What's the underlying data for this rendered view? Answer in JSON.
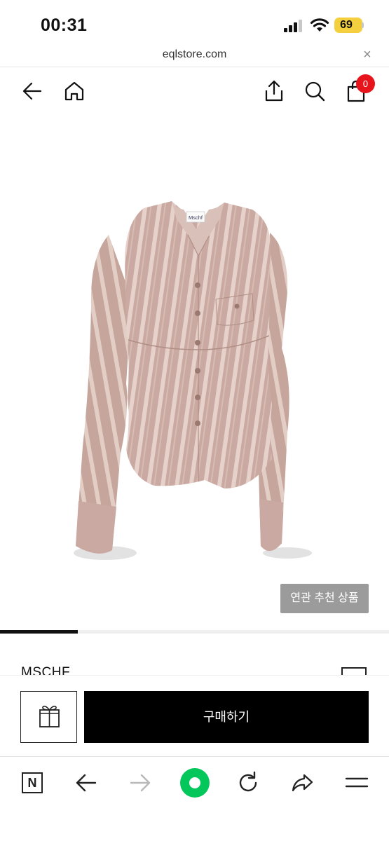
{
  "status_bar": {
    "time": "00:31",
    "battery": "69"
  },
  "browser": {
    "url": "eqlstore.com",
    "close_symbol": "×"
  },
  "header": {
    "icons": [
      "back-arrow-icon",
      "home-icon",
      "share-icon",
      "search-icon",
      "shopping-bag-icon"
    ],
    "cart_count": "0"
  },
  "product": {
    "image_alt": "Pink striped button-up shirt",
    "tag_label": "Mschf",
    "related_label": "연관 추천 상품",
    "brand": "MSCHF"
  },
  "slider": {
    "progress": 0.2
  },
  "purchase": {
    "gift_icon": "gift-icon",
    "buy_label": "구매하기"
  },
  "toolbar": {
    "n_label": "N",
    "icons": [
      "naver-icon",
      "back-icon",
      "forward-icon",
      "green-dot-icon",
      "reload-icon",
      "share-icon",
      "menu-icon"
    ]
  },
  "colors": {
    "badge": "#e8141c",
    "battery": "#f4d03f",
    "green": "#03c75a",
    "buy_button": "#000000",
    "related_button": "#9b9b9b"
  }
}
